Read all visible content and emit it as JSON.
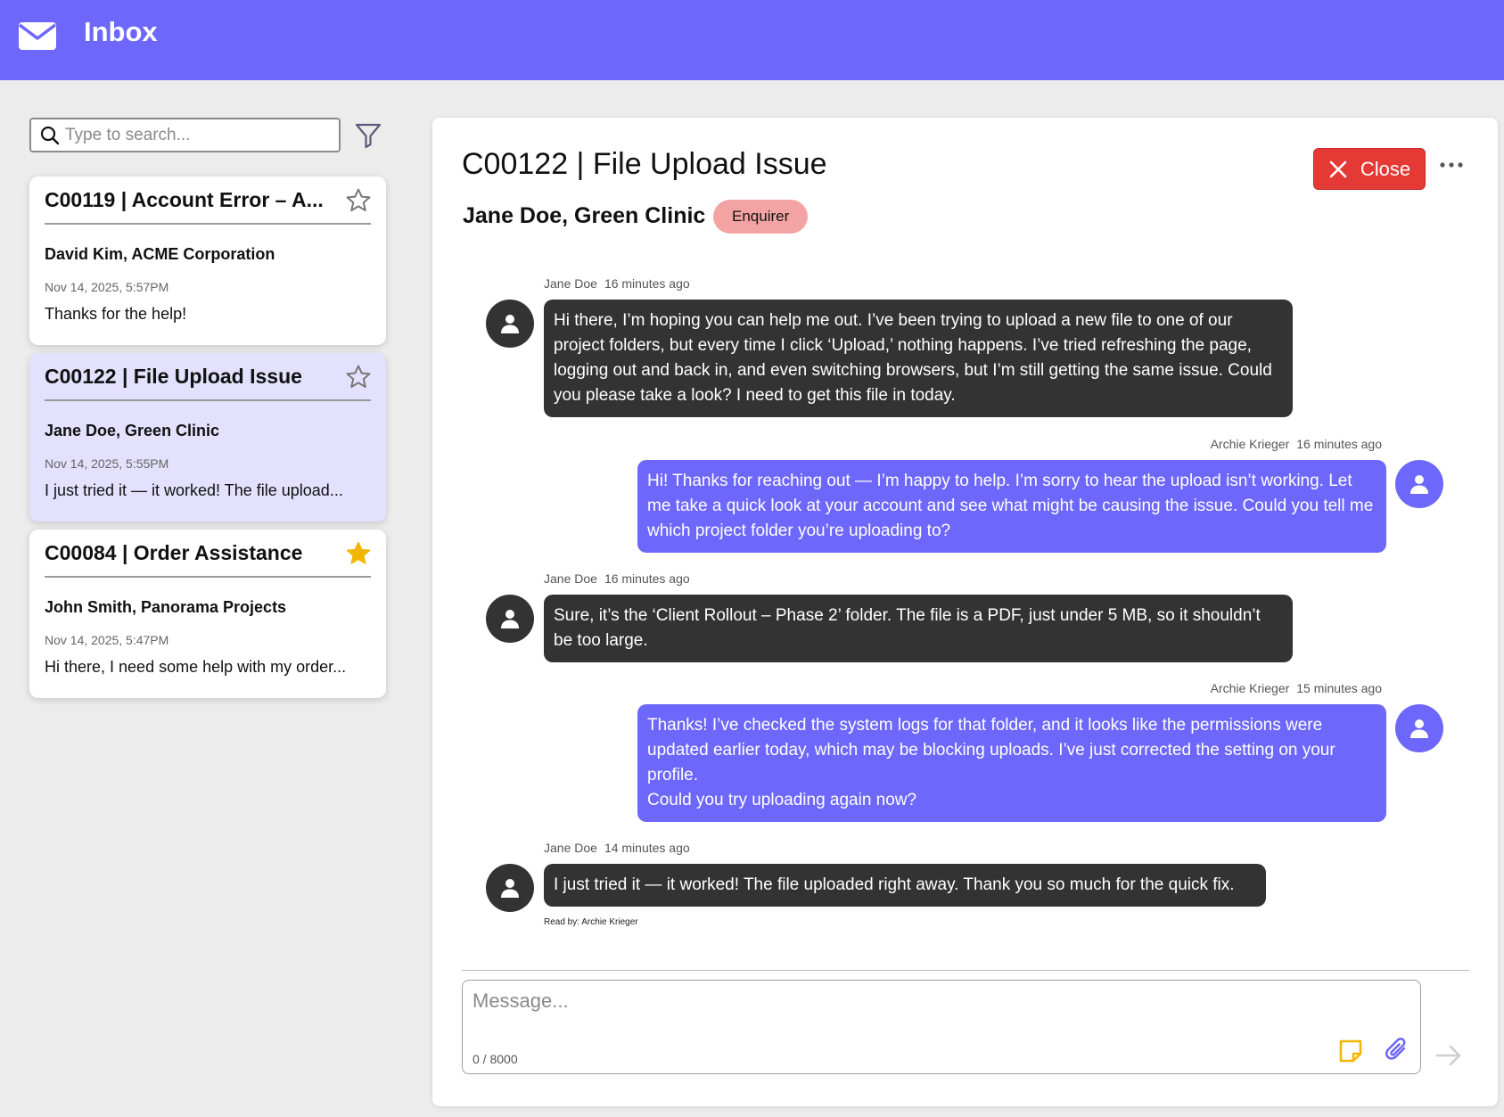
{
  "app": {
    "title": "Inbox"
  },
  "search": {
    "placeholder": "Type to search..."
  },
  "conversations": [
    {
      "title": "C00119 | Account Error – A...",
      "contact": "David Kim, ACME Corporation",
      "date": "Nov 14, 2025, 5:57PM",
      "preview": "Thanks for the help!",
      "starred": false,
      "selected": false
    },
    {
      "title": "C00122 | File Upload Issue",
      "contact": "Jane Doe, Green Clinic",
      "date": "Nov 14, 2025, 5:55PM",
      "preview": "I just tried it — it worked! The file upload...",
      "starred": false,
      "selected": true
    },
    {
      "title": "C00084 | Order Assistance",
      "contact": "John Smith, Panorama Projects",
      "date": "Nov 14, 2025, 5:47PM",
      "preview": "Hi there, I need some help with my order...",
      "starred": true,
      "selected": false
    }
  ],
  "conversation": {
    "title": "C00122 | File Upload Issue",
    "contact": "Jane Doe, Green Clinic",
    "role_badge": "Enquirer",
    "close_label": "Close",
    "messages": [
      {
        "direction": "inbound",
        "sender": "Jane Doe",
        "time": "16 minutes ago",
        "text": "Hi there, I’m hoping you can help me out. I’ve been trying to upload a new file to one of our project folders, but every time I click ‘Upload,’ nothing happens. I’ve tried refreshing the page, logging out and back in, and even switching browsers, but I’m still getting the same issue. Could you please take a look? I need to get this file in today."
      },
      {
        "direction": "outbound",
        "sender": "Archie Krieger",
        "time": "16 minutes ago",
        "text": "Hi! Thanks for reaching out — I’m happy to help. I’m sorry to hear the upload isn’t working. Let me take a quick look at your account and see what might be causing the issue. Could you tell me which project folder you’re uploading to?"
      },
      {
        "direction": "inbound",
        "sender": "Jane Doe",
        "time": "16 minutes ago",
        "text": "Sure, it’s the ‘Client Rollout – Phase 2’ folder. The file is a PDF, just under 5 MB, so it shouldn’t be too large."
      },
      {
        "direction": "outbound",
        "sender": "Archie Krieger",
        "time": "15 minutes ago",
        "text": "Thanks! I’ve checked the system logs for that folder, and it looks like the permissions were updated earlier today, which may be blocking uploads. I’ve just corrected the setting on your profile.\nCould you try uploading again now?"
      },
      {
        "direction": "inbound",
        "sender": "Jane Doe",
        "time": "14 minutes ago",
        "text": "I just tried it — it worked! The file uploaded right away. Thank you so much for the quick fix."
      }
    ],
    "read_by": "Read by: Archie Krieger"
  },
  "composer": {
    "placeholder": "Message...",
    "char_count": "0 / 8000"
  },
  "icons": {
    "logo": "envelope-icon",
    "search": "search-icon",
    "filter": "filter-icon",
    "star_empty": "star-outline-icon",
    "star_filled": "star-filled-icon",
    "close": "close-icon",
    "more": "more-horizontal-icon",
    "avatar": "user-icon",
    "note": "sticky-note-icon",
    "attach": "paperclip-icon",
    "send": "send-arrow-icon"
  },
  "colors": {
    "accent": "#6d67fb",
    "inbound_bubble": "#333333",
    "close_button": "#e53935",
    "badge": "#f3a3a3",
    "star_filled": "#f2b705",
    "selected_card": "#e3e1fd",
    "background": "#ececec"
  }
}
